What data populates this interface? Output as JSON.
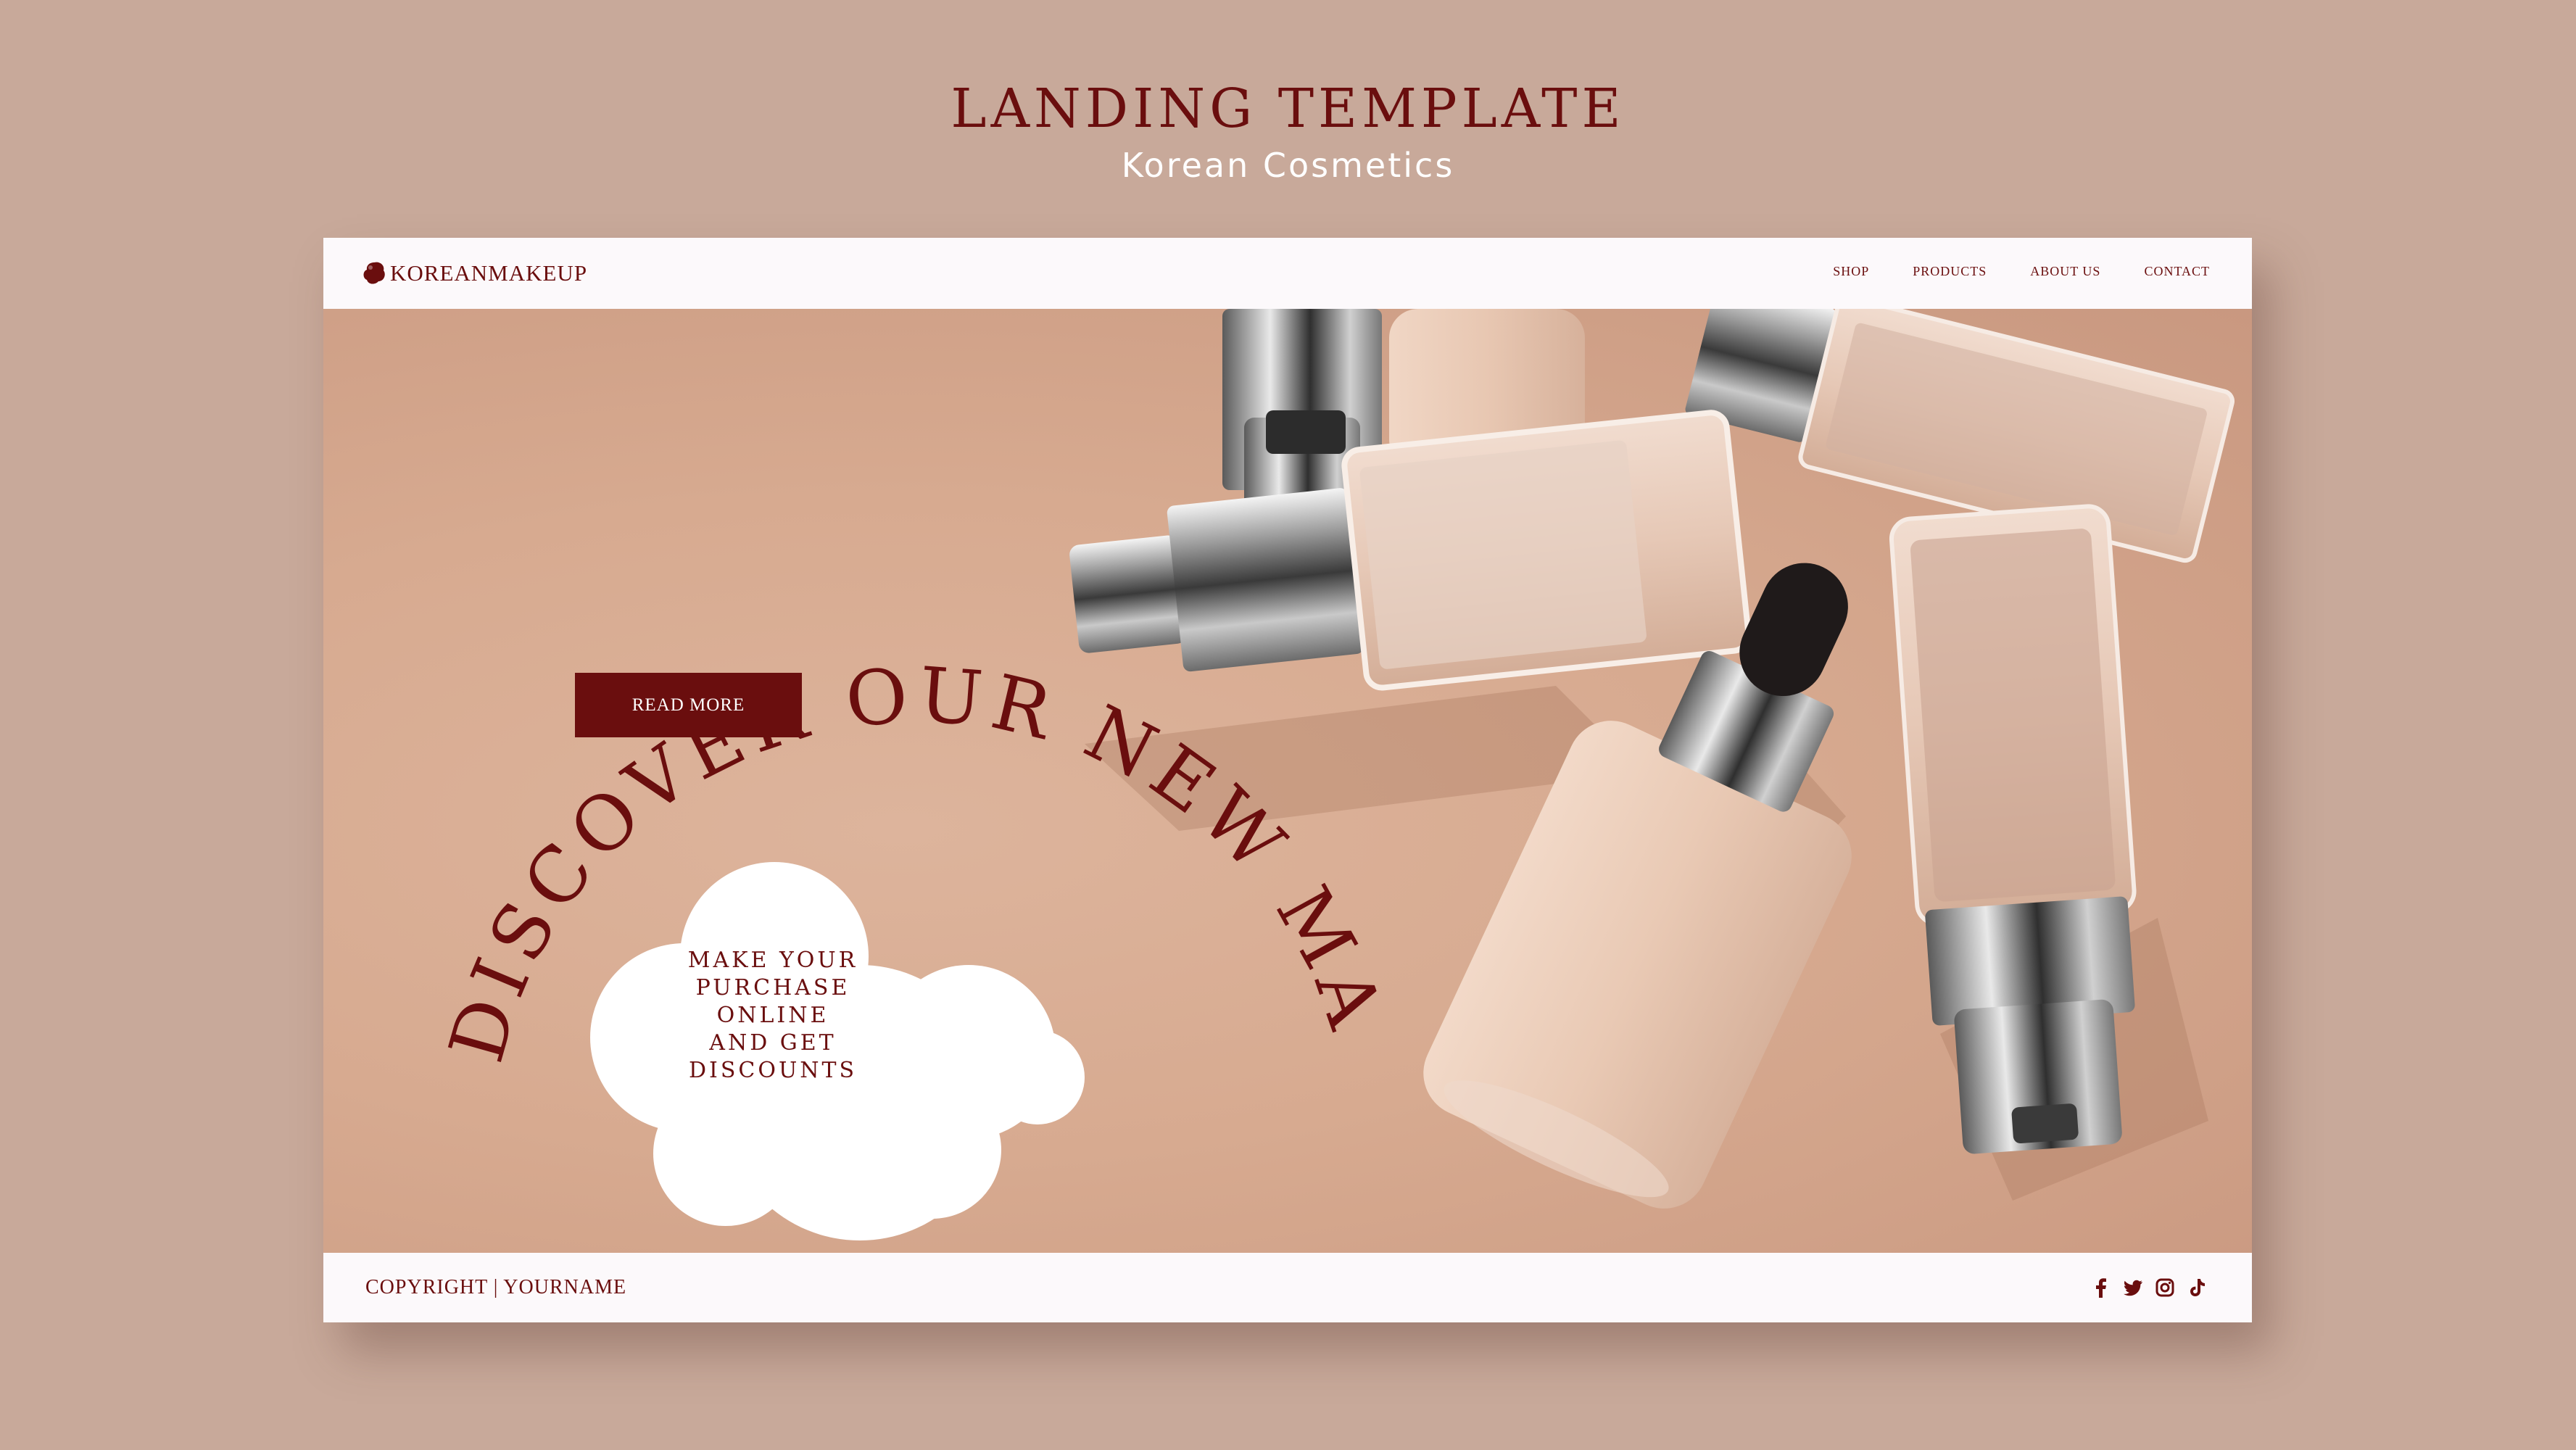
{
  "header": {
    "title": "LANDING TEMPLATE",
    "subtitle": "Korean Cosmetics"
  },
  "nav": {
    "logo_text": "KOREANMAKEUP",
    "logo_icon": "blob-logo-icon",
    "links": [
      "SHOP",
      "PRODUCTS",
      "ABOUT US",
      "CONTACT"
    ]
  },
  "hero": {
    "curved_headline": "DISCOVER OUR NEW MAKEUP PRODUCTS",
    "read_more_label": "READ MORE",
    "promo_lines": [
      "MAKE YOUR",
      "PURCHASE ONLINE",
      "AND GET",
      "DISCOUNTS"
    ],
    "image_subject": "foundation-bottles-photo"
  },
  "footer": {
    "copyright": "COPYRIGHT  |  YOURNAME",
    "social_icons": [
      "facebook-icon",
      "twitter-icon",
      "instagram-icon",
      "tiktok-icon"
    ]
  },
  "colors": {
    "background": "#c8a99a",
    "brand": "#6a0e0e",
    "panel": "#fcf9fb",
    "hero_base": "#d7aa90"
  }
}
